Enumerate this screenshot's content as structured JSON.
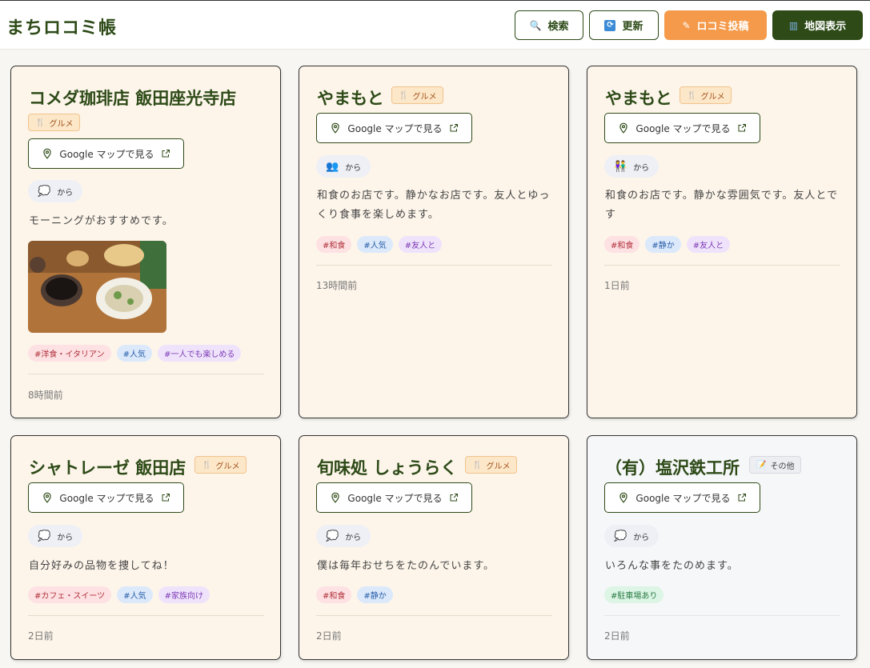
{
  "header": {
    "title": "まちロコミ帳",
    "search_label": "検索",
    "refresh_label": "更新",
    "post_label": "ロコミ投稿",
    "map_label": "地図表示"
  },
  "colors": {
    "brand": "#2d4a17",
    "accent": "#f59a4a"
  },
  "cards": [
    {
      "name": "コメダ珈琲店 飯田座光寺店",
      "category": "グルメ",
      "category_icon": "fork-knife-icon",
      "map_label": "Google マップで見る",
      "from": "から",
      "review": "モーニングがおすすめです。",
      "tags": [
        "#洋食・イタリアン",
        "#人気",
        "#一人でも楽しめる"
      ],
      "time": "8時間前"
    },
    {
      "name": "やまもと",
      "category": "グルメ",
      "category_icon": "fork-knife-icon",
      "map_label": "Google マップで見る",
      "from": "から",
      "review": "和食のお店です。静かなお店です。友人とゆっくり食事を楽しめます。",
      "tags": [
        "#和食",
        "#人気",
        "#友人と"
      ],
      "time": "13時間前"
    },
    {
      "name": "やまもと",
      "category": "グルメ",
      "category_icon": "fork-knife-icon",
      "map_label": "Google マップで見る",
      "from": "から",
      "review": "和食のお店です。静かな雰囲気です。友人とです",
      "tags": [
        "#和食",
        "#静か",
        "#友人と"
      ],
      "time": "1日前"
    },
    {
      "name": "シャトレーゼ 飯田店",
      "category": "グルメ",
      "category_icon": "fork-knife-icon",
      "map_label": "Google マップで見る",
      "from": "から",
      "review": "自分好みの品物を捜してね！",
      "tags": [
        "#カフェ・スイーツ",
        "#人気",
        "#家族向け"
      ],
      "time": "2日前"
    },
    {
      "name": "旬味処 しょうらく",
      "category": "グルメ",
      "category_icon": "fork-knife-icon",
      "map_label": "Google マップで見る",
      "from": "から",
      "review": "僕は毎年おせちをたのんでいます。",
      "tags": [
        "#和食",
        "#静か"
      ],
      "time": "2日前"
    },
    {
      "name": "（有）塩沢鉄工所",
      "category": "その他",
      "category_icon": "memo-icon",
      "map_label": "Google マップで見る",
      "from": "から",
      "review": "いろんな事をたのめます。",
      "tags": [
        "#駐車場あり"
      ],
      "time": "2日前"
    }
  ]
}
